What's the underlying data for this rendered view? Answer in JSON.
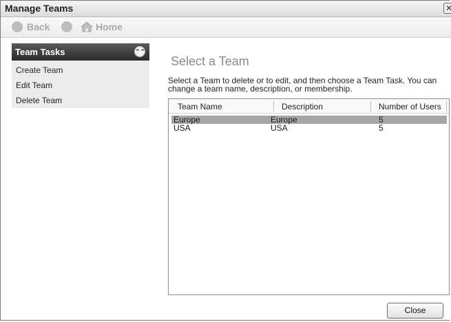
{
  "window": {
    "title": "Manage Teams",
    "close_glyph": "✕"
  },
  "nav": {
    "back_label": "Back",
    "home_label": "Home"
  },
  "sidebar": {
    "header": "Team Tasks",
    "collapse_glyph": "⌃⌃",
    "items": [
      {
        "label": "Create Team"
      },
      {
        "label": "Edit Team"
      },
      {
        "label": "Delete Team"
      }
    ]
  },
  "main": {
    "title": "Select a Team",
    "instructions": "Select a Team to delete or to edit, and then choose a Team Task. You can change a team name, description, or membership."
  },
  "table": {
    "columns": [
      "Team Name",
      "Description",
      "Number of Users"
    ],
    "rows": [
      {
        "name": "Europe",
        "description": "Europe",
        "users": "5",
        "selected": true
      },
      {
        "name": "USA",
        "description": "USA",
        "users": "5",
        "selected": false
      }
    ]
  },
  "footer": {
    "close_label": "Close"
  }
}
